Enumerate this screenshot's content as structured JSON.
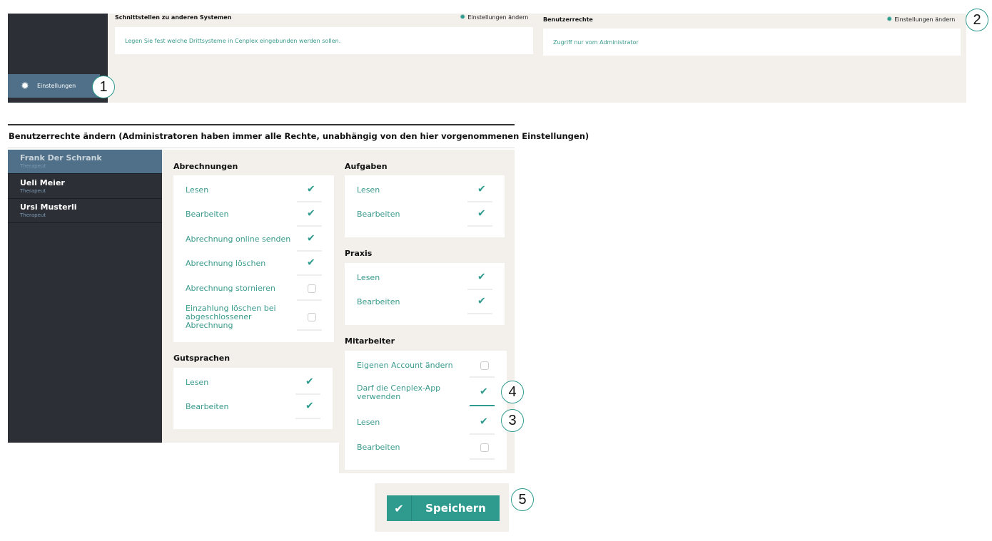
{
  "sidebar": {
    "settings_label": "Einstellungen",
    "settings_icon": "gear-icon"
  },
  "interfaces": {
    "title": "Schnittstellen zu anderen Systemen",
    "change_link": "Einstellungen ändern",
    "description": "Legen Sie fest welche Drittsysteme in Cenplex eingebunden werden sollen."
  },
  "user_rights": {
    "title": "Benutzerrechte",
    "change_link": "Einstellungen ändern",
    "description": "Zugriff nur vom Administrator"
  },
  "edit_rights": {
    "title": "Benutzerrechte ändern (Administratoren haben immer alle Rechte, unabhängig von den hier vorgenommenen Einstellungen)",
    "users": [
      {
        "name": "Frank Der Schrank",
        "role": "Therapeut",
        "active": true
      },
      {
        "name": "Ueli  Meier",
        "role": "Therapeut",
        "active": false
      },
      {
        "name": "Ursi Musterli",
        "role": "Therapeut",
        "active": false
      }
    ],
    "groups": {
      "abrechnungen": {
        "title": "Abrechnungen",
        "items": [
          {
            "label": "Lesen",
            "checked": true
          },
          {
            "label": "Bearbeiten",
            "checked": true
          },
          {
            "label": "Abrechnung online senden",
            "checked": true
          },
          {
            "label": "Abrechnung löschen",
            "checked": true
          },
          {
            "label": "Abrechnung stornieren",
            "checked": false
          },
          {
            "label": "Einzahlung löschen bei abgeschlossener Abrechnung",
            "checked": false
          }
        ]
      },
      "gutsprachen": {
        "title": "Gutsprachen",
        "items": [
          {
            "label": "Lesen",
            "checked": true
          },
          {
            "label": "Bearbeiten",
            "checked": true
          }
        ]
      },
      "aufgaben": {
        "title": "Aufgaben",
        "items": [
          {
            "label": "Lesen",
            "checked": true
          },
          {
            "label": "Bearbeiten",
            "checked": true
          }
        ]
      },
      "praxis": {
        "title": "Praxis",
        "items": [
          {
            "label": "Lesen",
            "checked": true
          },
          {
            "label": "Bearbeiten",
            "checked": true
          }
        ]
      },
      "mitarbeiter": {
        "title": "Mitarbeiter",
        "items": [
          {
            "label": "Eigenen Account ändern",
            "checked": false
          },
          {
            "label": "Darf die Cenplex-App verwenden",
            "checked": true
          },
          {
            "label": "Lesen",
            "checked": true
          },
          {
            "label": "Bearbeiten",
            "checked": false
          }
        ]
      }
    }
  },
  "save_label": "Speichern",
  "callouts": [
    "1",
    "2",
    "3",
    "4",
    "5"
  ],
  "colors": {
    "accent": "#2f9b8e",
    "sidebar": "#2c3036",
    "active_user": "#4f7088",
    "panel": "#f3f0ec"
  }
}
